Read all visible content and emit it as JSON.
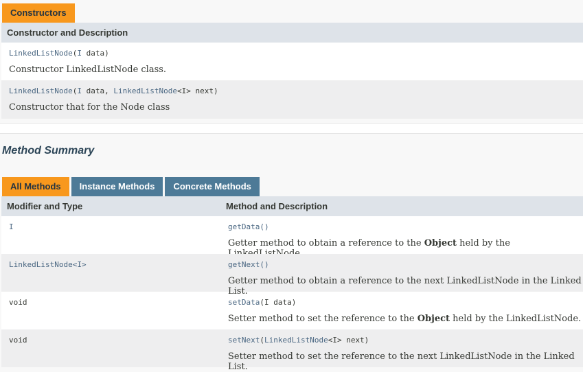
{
  "constructors": {
    "tab_label": "Constructors",
    "header": "Constructor and Description",
    "rows": [
      {
        "name": "LinkedListNode",
        "params_prefix": "(",
        "params_type1": "I",
        "params_rest1": " data",
        "params_type2": "",
        "params_rest2": ")",
        "description": "Constructor LinkedListNode class."
      },
      {
        "name": "LinkedListNode",
        "params_prefix": "(",
        "params_type1": "I",
        "params_rest1": " data, ",
        "params_type2": "LinkedListNode",
        "params_rest2": "<I> next)",
        "description": "Constructor that for the Node class"
      }
    ]
  },
  "method_summary": {
    "title": "Method Summary",
    "tabs": [
      {
        "label": "All Methods",
        "active": true
      },
      {
        "label": "Instance Methods",
        "active": false
      },
      {
        "label": "Concrete Methods",
        "active": false
      }
    ],
    "headers": {
      "col1": "Modifier and Type",
      "col2": "Method and Description"
    },
    "rows": [
      {
        "type": "I",
        "type_is_link": true,
        "method": "getData",
        "params": "()",
        "desc_before": "Getter method to obtain a reference to the ",
        "desc_bold": "Object",
        "desc_after": " held by the LinkedListNode."
      },
      {
        "type": "LinkedListNode<I>",
        "type_is_link": true,
        "method": "getNext",
        "params": "()",
        "desc_before": "Getter method to obtain a reference to the next LinkedListNode in the Linked List.",
        "desc_bold": "",
        "desc_after": ""
      },
      {
        "type": "void",
        "type_is_link": false,
        "method": "setData",
        "params": "(I data)",
        "desc_before": "Setter method to set the reference to the ",
        "desc_bold": "Object",
        "desc_after": " held by the LinkedListNode."
      },
      {
        "type": "void",
        "type_is_link": false,
        "method": "setNext",
        "params_link": "LinkedListNode",
        "params_open": "(",
        "params_rest": "<I> next)",
        "desc_before": "Setter method to set the reference to the next LinkedListNode in the Linked List.",
        "desc_bold": "",
        "desc_after": ""
      }
    ]
  },
  "colors": {
    "accent_orange": "#f8981d",
    "tab_blue": "#4d7a97",
    "header_gray": "#dee3e9",
    "link": "#4a6782"
  }
}
